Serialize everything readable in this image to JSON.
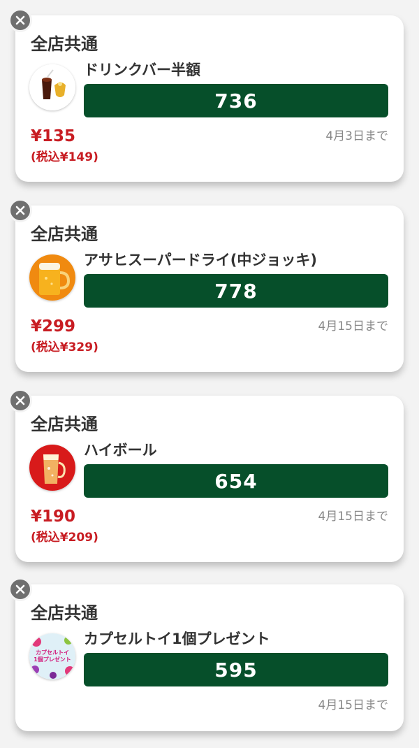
{
  "colors": {
    "background": "#f3f3f3",
    "card": "#ffffff",
    "code_bar": "#064f2a",
    "price": "#c81c22",
    "expiry": "#888888",
    "close_button": "#6f6f6f"
  },
  "coupons": [
    {
      "store_label": "全店共通",
      "item_name": "ドリンクバー半額",
      "code": "736",
      "price": "¥135",
      "price_tax": "(税込¥149)",
      "expiry": "4月3日まで",
      "icon": "close-icon"
    },
    {
      "store_label": "全店共通",
      "item_name": "アサヒスーパードライ(中ジョッキ)",
      "code": "778",
      "price": "¥299",
      "price_tax": "(税込¥329)",
      "expiry": "4月15日まで",
      "icon": "close-icon"
    },
    {
      "store_label": "全店共通",
      "item_name": "ハイボール",
      "code": "654",
      "price": "¥190",
      "price_tax": "(税込¥209)",
      "expiry": "4月15日まで",
      "icon": "close-icon"
    },
    {
      "store_label": "全店共通",
      "item_name": "カプセルトイ1個プレゼント",
      "code": "595",
      "price": "",
      "price_tax": "",
      "expiry": "4月15日まで",
      "icon": "close-icon",
      "thumb_text": [
        "カプセルトイ",
        "1個プレゼント"
      ]
    }
  ]
}
